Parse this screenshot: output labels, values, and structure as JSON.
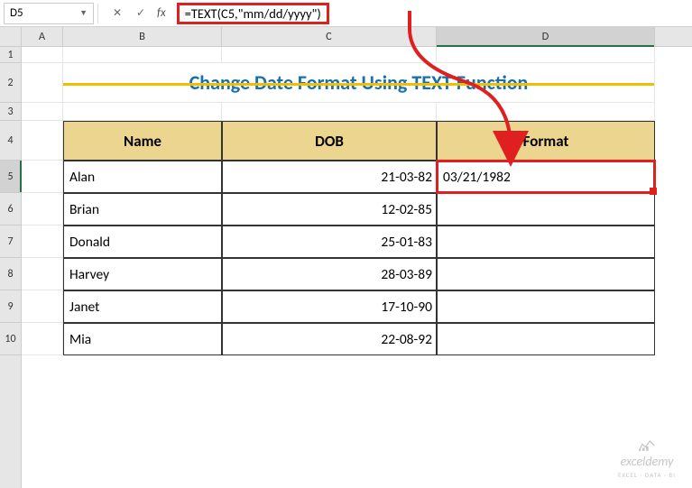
{
  "formula_bar": {
    "cell_ref": "D5",
    "formula": "=TEXT(C5,\"mm/dd/yyyy\")"
  },
  "columns": {
    "A": "A",
    "B": "B",
    "C": "C",
    "D": "D"
  },
  "row_numbers": [
    "1",
    "2",
    "3",
    "4",
    "5",
    "6",
    "7",
    "8",
    "9",
    "10"
  ],
  "title": "Change Date Format Using TEXT Function",
  "table": {
    "headers": {
      "name": "Name",
      "dob": "DOB",
      "format": "Format"
    },
    "rows": [
      {
        "name": "Alan",
        "dob": "21-03-82",
        "format": "03/21/1982"
      },
      {
        "name": "Brian",
        "dob": "12-02-85",
        "format": ""
      },
      {
        "name": "Donald",
        "dob": "25-01-83",
        "format": ""
      },
      {
        "name": "Harvey",
        "dob": "28-03-89",
        "format": ""
      },
      {
        "name": "Janet",
        "dob": "17-10-90",
        "format": ""
      },
      {
        "name": "Mia",
        "dob": "22-08-92",
        "format": ""
      }
    ]
  },
  "watermark": {
    "title": "exceldemy",
    "subtitle": "EXCEL · DATA · BI"
  },
  "selected_cell": "D5"
}
